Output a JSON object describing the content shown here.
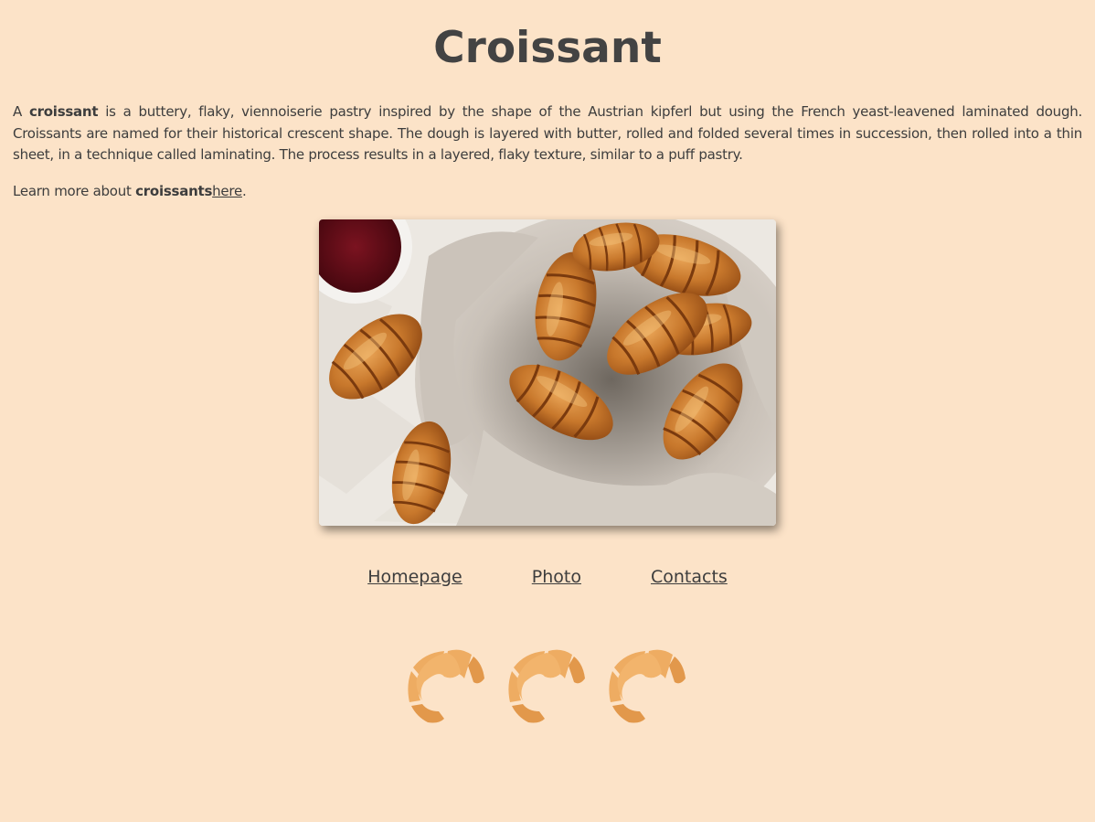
{
  "page": {
    "title": "Croissant"
  },
  "intro": {
    "text_a": "A ",
    "bold_term": "croissant",
    "text_b": " is a buttery, flaky, viennoiserie pastry inspired by the shape of the Austrian kipferl but using the French yeast-leavened laminated dough. Croissants are named for their historical crescent shape. The dough is layered with butter, rolled and folded several times in succession, then rolled into a thin sheet, in a technique called laminating. The process results in a layered, flaky texture, similar to a puff pastry."
  },
  "learn_more": {
    "prefix": "Learn more about ",
    "bold_term": "croissants",
    "link_label": "here",
    "suffix": "."
  },
  "photo": {
    "subject": "croissants in linen basket with jam",
    "colors": {
      "paper": "#ece8e2",
      "linen": "#cdc5bc",
      "crust": "#c8782c",
      "crust_dark": "#9a4f16",
      "jam": "#5b0a14"
    }
  },
  "nav": {
    "items": [
      {
        "label": "Homepage"
      },
      {
        "label": "Photo"
      },
      {
        "label": "Contacts"
      }
    ]
  },
  "icons": {
    "name": "croissant-icon",
    "count": 3,
    "color": "#eeac62",
    "color_dark": "#e2984b"
  },
  "theme": {
    "background": "#fce3c8",
    "text": "#3d3d3d"
  }
}
